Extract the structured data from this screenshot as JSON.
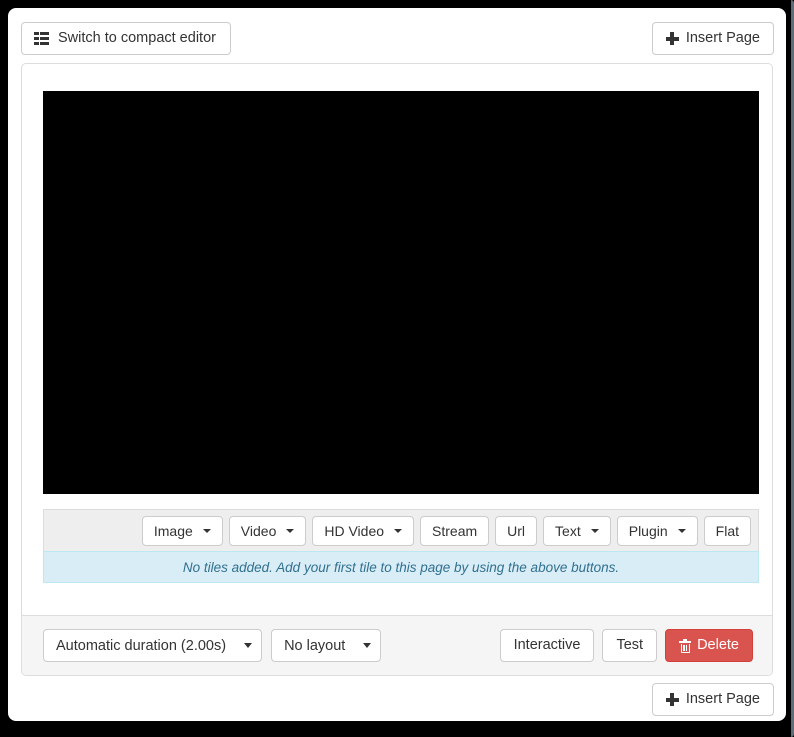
{
  "topbar": {
    "switch_editor_label": "Switch to compact editor",
    "switch_editor_icon": "th-list-icon",
    "insert_page_label": "Insert Page",
    "insert_page_icon": "plus-icon"
  },
  "panel": {
    "preview": {
      "name": "page-preview-canvas",
      "background_color": "#000000"
    },
    "tile_buttons": [
      {
        "label": "Image",
        "has_caret": true
      },
      {
        "label": "Video",
        "has_caret": true
      },
      {
        "label": "HD Video",
        "has_caret": true
      },
      {
        "label": "Stream",
        "has_caret": false
      },
      {
        "label": "Url",
        "has_caret": false
      },
      {
        "label": "Text",
        "has_caret": true
      },
      {
        "label": "Plugin",
        "has_caret": true
      },
      {
        "label": "Flat",
        "has_caret": false
      }
    ],
    "alert": {
      "message": "No tiles added. Add your first tile to this page by using the above buttons.",
      "background_color": "#d9edf7",
      "border_color": "#bce8f1",
      "text_color": "#31708f"
    },
    "footer": {
      "duration_select": "Automatic duration (2.00s)",
      "layout_select": "No layout",
      "interactive_label": "Interactive",
      "test_label": "Test",
      "delete_label": "Delete",
      "delete_icon": "trash-icon",
      "delete_color": "#d9534f"
    }
  },
  "bottombar": {
    "insert_page_label": "Insert Page",
    "insert_page_icon": "plus-icon"
  }
}
